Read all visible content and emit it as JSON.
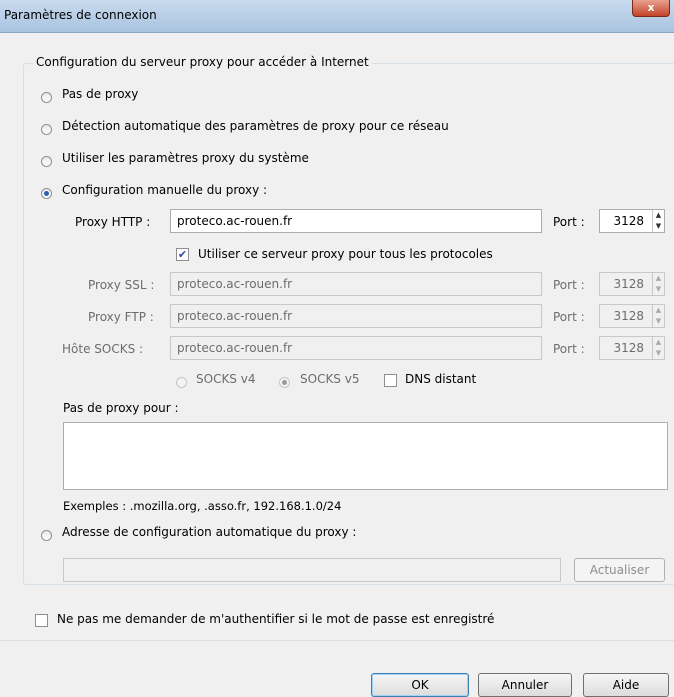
{
  "window": {
    "title": "Paramètres de connexion",
    "close_glyph": "x"
  },
  "group": {
    "legend": "Configuration du serveur proxy pour accéder à Internet"
  },
  "radios": [
    {
      "label": "Pas de proxy"
    },
    {
      "label": "Détection automatique des paramètres de proxy pour ce réseau"
    },
    {
      "label": "Utiliser les paramètres proxy du système"
    },
    {
      "label": "Configuration manuelle du proxy :"
    }
  ],
  "manual": {
    "http_label": "Proxy HTTP :",
    "http_value": "proteco.ac-rouen.fr",
    "port_label": "Port :",
    "http_port": "3128",
    "same_proxy_label": "Utiliser ce serveur proxy pour tous les protocoles",
    "ssl_label": "Proxy SSL :",
    "ssl_value": "proteco.ac-rouen.fr",
    "ssl_port": "3128",
    "ftp_label": "Proxy FTP :",
    "ftp_value": "proteco.ac-rouen.fr",
    "ftp_port": "3128",
    "socks_label": "Hôte SOCKS :",
    "socks_value": "proteco.ac-rouen.fr",
    "socks_port": "3128",
    "socks4_label": "SOCKS v4",
    "socks5_label": "SOCKS v5",
    "dns_label": "DNS distant"
  },
  "no_proxy": {
    "label": "Pas de proxy pour :",
    "value": "",
    "examples": "Exemples : .mozilla.org, .asso.fr, 192.168.1.0/24"
  },
  "auto_config": {
    "label": "Adresse de configuration automatique du proxy :",
    "value": "",
    "reload_label": "Actualiser"
  },
  "auth": {
    "label": "Ne pas me demander de m'authentifier si le mot de passe est enregistré"
  },
  "buttons": {
    "ok": "OK",
    "cancel": "Annuler",
    "help": "Aide"
  }
}
